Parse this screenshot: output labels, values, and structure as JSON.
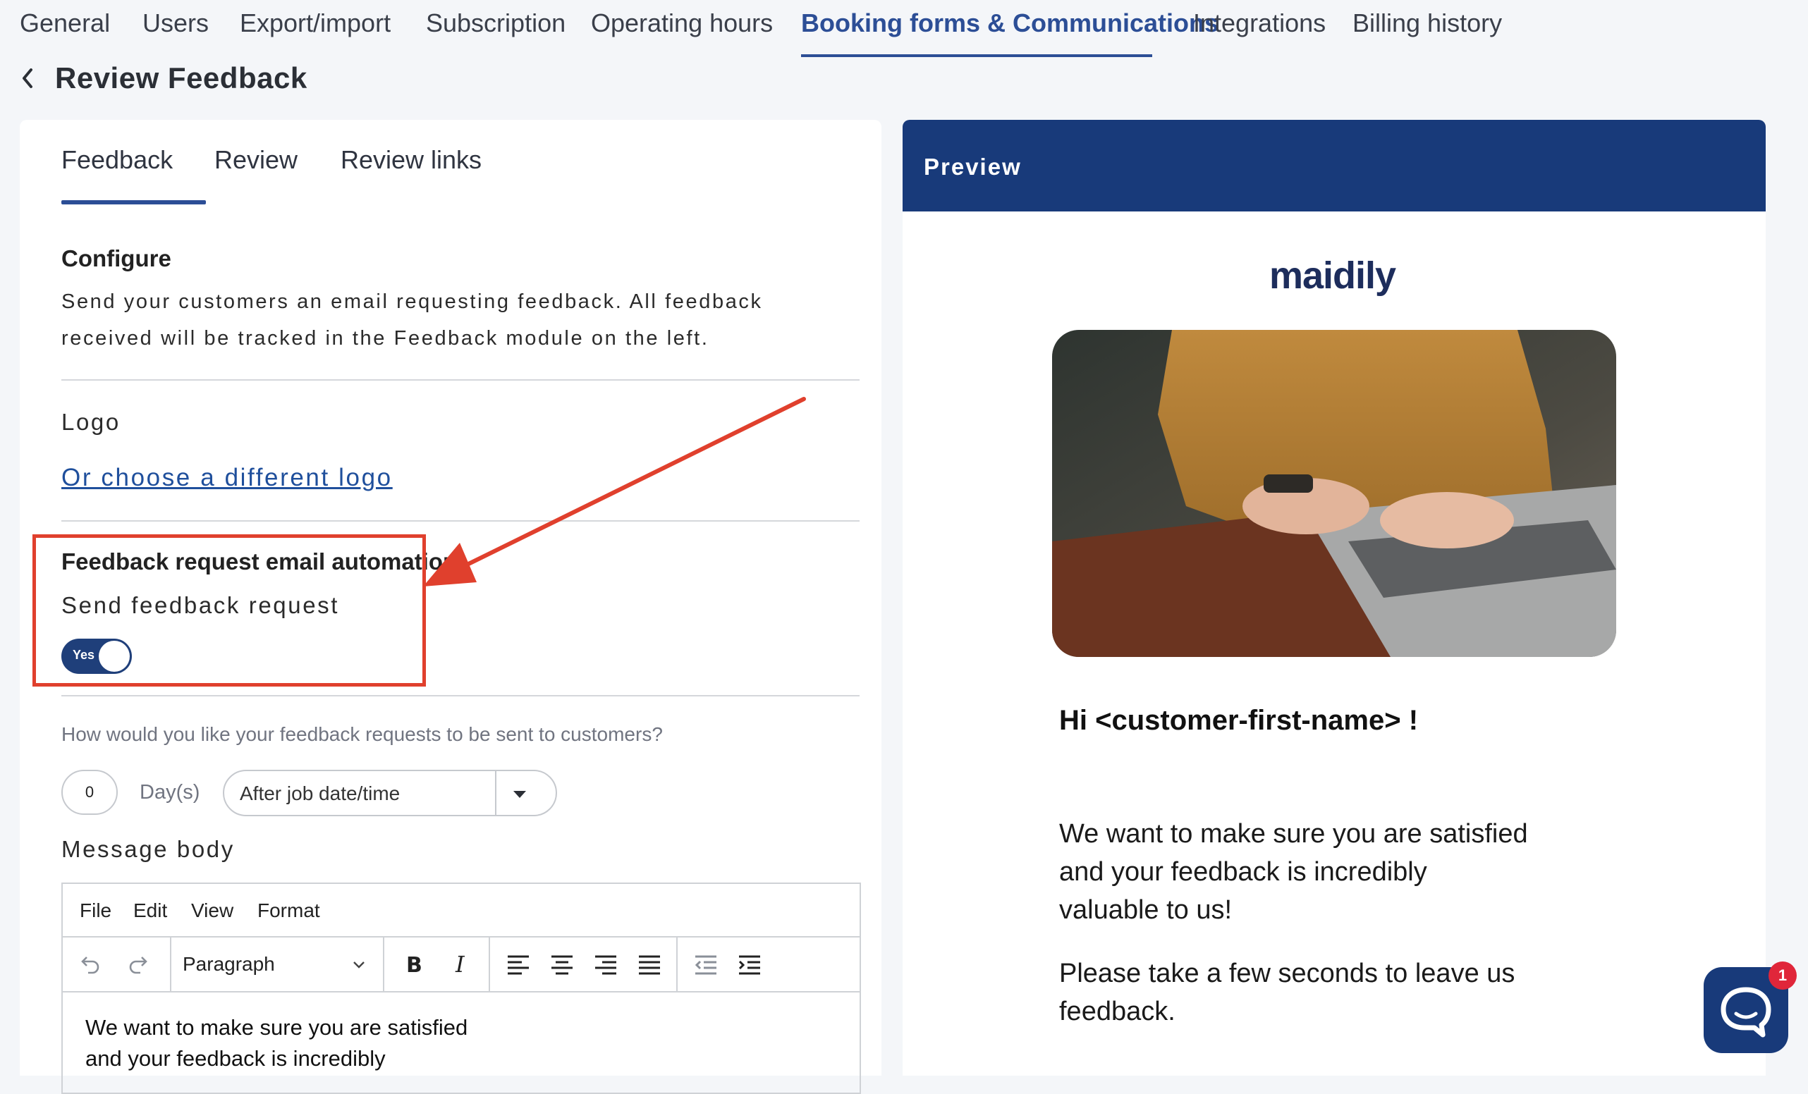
{
  "nav": {
    "items": [
      "General",
      "Users",
      "Export/import",
      "Subscription",
      "Operating hours",
      "Booking forms & Communications",
      "Integrations",
      "Billing history"
    ],
    "active": "Booking forms & Communications"
  },
  "page": {
    "title": "Review Feedback"
  },
  "subtabs": [
    "Feedback",
    "Review",
    "Review links"
  ],
  "configure": {
    "heading": "Configure",
    "description": "Send your customers an email requesting feedback. All feedback received will be tracked in the Feedback module on the left."
  },
  "logo_section": {
    "label": "Logo",
    "link": "Or choose a different logo"
  },
  "automation": {
    "heading": "Feedback request email automation",
    "label": "Send feedback request",
    "toggle_label": "Yes",
    "toggle_on": true
  },
  "schedule": {
    "question": "How would you like your feedback requests to be sent to customers?",
    "days_value": "0",
    "days_label": "Day(s)",
    "timing_selected": "After job date/time"
  },
  "message": {
    "label": "Message body",
    "menu": [
      "File",
      "Edit",
      "View",
      "Format"
    ],
    "paragraph_select": "Paragraph",
    "body_line1": "We want to make sure you are satisfied",
    "body_line2": "and your feedback is incredibly"
  },
  "preview": {
    "title": "Preview",
    "brand": "maidily",
    "greeting": "Hi <customer-first-name> !",
    "para1": [
      "We want to make sure you are satisfied",
      "and your feedback is incredibly",
      "valuable to us!"
    ],
    "para2": [
      "Please take a few seconds to leave us",
      "feedback."
    ]
  },
  "chat": {
    "badge": "1"
  },
  "colors": {
    "accent": "#2c4e96",
    "header": "#183a7a",
    "annotation": "#e0402d",
    "badge": "#e0263a"
  }
}
